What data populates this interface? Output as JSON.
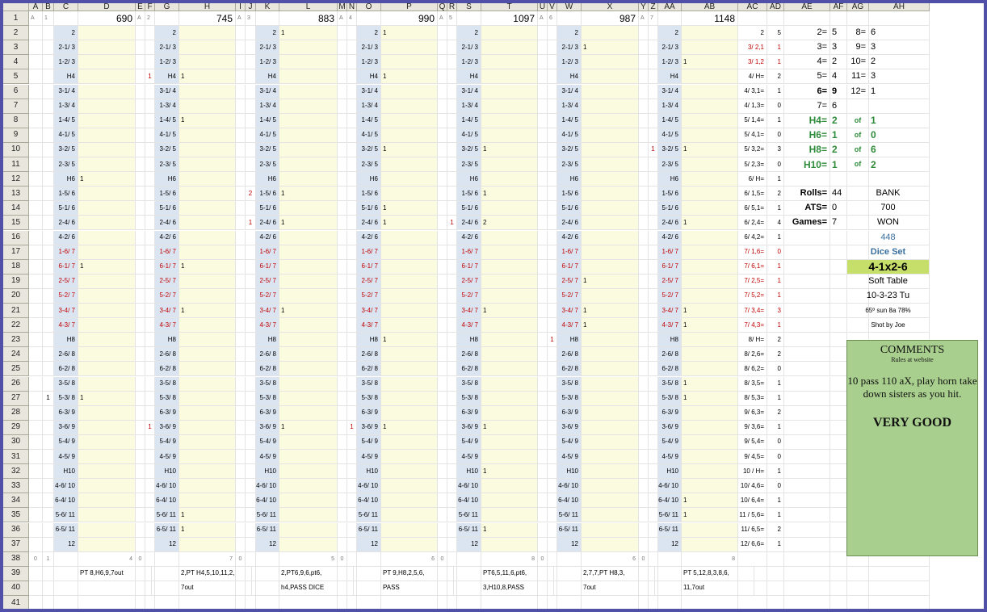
{
  "columns": [
    "A",
    "B",
    "C",
    "D",
    "E",
    "F",
    "G",
    "H",
    "I",
    "J",
    "K",
    "L",
    "M",
    "N",
    "O",
    "P",
    "Q",
    "R",
    "S",
    "T",
    "U",
    "V",
    "W",
    "X",
    "Y",
    "Z",
    "AA",
    "AB",
    "AC",
    "AD",
    "AE",
    "AF",
    "AG",
    "AH"
  ],
  "rows": [
    "1",
    "2",
    "3",
    "4",
    "5",
    "6",
    "7",
    "8",
    "9",
    "10",
    "11",
    "12",
    "13",
    "14",
    "15",
    "16",
    "17",
    "18",
    "19",
    "20",
    "21",
    "22",
    "23",
    "24",
    "25",
    "26",
    "27",
    "28",
    "29",
    "30",
    "31",
    "32",
    "33",
    "34",
    "35",
    "36",
    "37",
    "38",
    "39",
    "40",
    "41"
  ],
  "roll_labels": [
    "2",
    "2-1/ 3",
    "1-2/ 3",
    "H4",
    "3-1/ 4",
    "1-3/ 4",
    "1-4/ 5",
    "4-1/ 5",
    "3-2/ 5",
    "2-3/ 5",
    "H6",
    "1-5/ 6",
    "5-1/ 6",
    "2-4/ 6",
    "4-2/ 6",
    "1-6/ 7",
    "6-1/ 7",
    "2-5/ 7",
    "5-2/ 7",
    "3-4/ 7",
    "4-3/ 7",
    "H8",
    "2-6/ 8",
    "6-2/ 8",
    "3-5/ 8",
    "5-3/ 8",
    "6-3/ 9",
    "3-6/ 9",
    "5-4/ 9",
    "4-5/ 9",
    "H10",
    "4-6/ 10",
    "6-4/ 10",
    "5-6/ 11",
    "6-5/ 11",
    "12"
  ],
  "games": [
    {
      "letter": "A",
      "num": "1",
      "score": "690",
      "bottom_a": "0",
      "bottom_b": "1",
      "bottom_c": "4",
      "note1": "PT 8,H6,9,7out",
      "note2": "",
      "left_marks": {
        "27": "1"
      },
      "right_marks": {
        "2": "",
        "12": "1",
        "18": "1",
        "27": "1"
      }
    },
    {
      "letter": "A",
      "num": "2",
      "score": "745",
      "bottom_a": "0",
      "bottom_b": "",
      "bottom_c": "7",
      "note1": "2,PT H4,5,10,11,2,",
      "note2": "7out",
      "left_marks": {
        "5": "1",
        "29": "1"
      },
      "right_marks": {
        "5": "1",
        "8": "1",
        "18": "1",
        "21": "1",
        "35": "1",
        "36": "1"
      }
    },
    {
      "letter": "A",
      "num": "3",
      "score": "883",
      "bottom_a": "0",
      "bottom_b": "",
      "bottom_c": "5",
      "note1": "2,PT6,9,6,pt6,",
      "note2": "h4,PASS DICE",
      "left_marks": {
        "13": "2",
        "15": "1"
      },
      "right_marks": {
        "2": "1",
        "13": "1",
        "15": "1",
        "21": "1",
        "29": "1"
      }
    },
    {
      "letter": "A",
      "num": "4",
      "score": "990",
      "bottom_a": "0",
      "bottom_b": "",
      "bottom_c": "6",
      "note1": "PT 9,H8,2,5,6,",
      "note2": "PASS",
      "left_marks": {
        "29": "1"
      },
      "right_marks": {
        "2": "1",
        "5": "1",
        "10": "1",
        "14": "1",
        "15": "1",
        "23": "1",
        "29": "1"
      }
    },
    {
      "letter": "A",
      "num": "5",
      "score": "1097",
      "bottom_a": "0",
      "bottom_b": "",
      "bottom_c": "8",
      "note1": "PT6,5,11,6,pt6,",
      "note2": "3,H10,8,PASS",
      "left_marks": {
        "15": "1"
      },
      "right_marks": {
        "10": "1",
        "13": "1",
        "15": "2",
        "21": "1",
        "29": "1",
        "32": "1",
        "36": "1"
      }
    },
    {
      "letter": "A",
      "num": "6",
      "score": "987",
      "bottom_a": "0",
      "bottom_b": "",
      "bottom_c": "6",
      "note1": "2,7,7,PT H8,3,",
      "note2": "7out",
      "left_marks": {
        "23": "1"
      },
      "right_marks": {
        "3": "1",
        "19": "1",
        "21": "1",
        "22": "1"
      }
    },
    {
      "letter": "A",
      "num": "7",
      "score": "1148",
      "bottom_a": "0",
      "bottom_b": "",
      "bottom_c": "8",
      "note1": "PT 5,12,8,3,8,6,",
      "note2": "11,7out",
      "left_marks": {
        "10": "1"
      },
      "right_marks": {
        "4": "1",
        "10": "1",
        "15": "1",
        "21": "1",
        "22": "1",
        "26": "1",
        "27": "1",
        "34": "1",
        "35": "1"
      }
    }
  ],
  "ac_col": [
    "2",
    "3/ 2,1",
    "3/ 1,2",
    "4/ H=",
    "4/ 3,1=",
    "4/ 1,3=",
    "5/ 1,4=",
    "5/ 4,1=",
    "5/ 3,2=",
    "5/ 2,3=",
    "6/ H=",
    "6/ 1,5=",
    "6/ 5,1=",
    "6/ 2,4=",
    "6/ 4,2=",
    "7/ 1,6=",
    "7/ 6,1=",
    "7/ 2,5=",
    "7/ 5,2=",
    "7/ 3,4=",
    "7/ 4,3=",
    "8/ H=",
    "8/ 2,6=",
    "8/ 6,2=",
    "8/ 3,5=",
    "8/ 5,3=",
    "9/ 6,3=",
    "9/ 3,6=",
    "9/ 5,4=",
    "9/ 4,5=",
    "10 / H=",
    "10/ 4,6=",
    "10/ 6,4=",
    "11 / 5,6=",
    "11/ 6,5=",
    "12/ 6,6="
  ],
  "ad_col": [
    "5",
    "1",
    "1",
    "2",
    "1",
    "0",
    "1",
    "0",
    "3",
    "0",
    "1",
    "2",
    "1",
    "4",
    "1",
    "0",
    "1",
    "1",
    "1",
    "3",
    "1",
    "2",
    "2",
    "0",
    "1",
    "1",
    "2",
    "1",
    "0",
    "0",
    "1",
    "0",
    "1",
    "1",
    "2",
    "1"
  ],
  "totals": [
    {
      "left": "2=",
      "lv": "5",
      "right": "8=",
      "rv": "6"
    },
    {
      "left": "3=",
      "lv": "3",
      "right": "9=",
      "rv": "3"
    },
    {
      "left": "4=",
      "lv": "2",
      "right": "10=",
      "rv": "2"
    },
    {
      "left": "5=",
      "lv": "4",
      "right": "11=",
      "rv": "3"
    },
    {
      "left": "6=",
      "lv": "9",
      "right": "12=",
      "rv": "1"
    },
    {
      "left": "7=",
      "lv": "6",
      "right": "",
      "rv": ""
    }
  ],
  "hardways": [
    {
      "label": "H4=",
      "val": "2",
      "of": "of",
      "cnt": "1"
    },
    {
      "label": "H6=",
      "val": "1",
      "of": "of",
      "cnt": "0"
    },
    {
      "label": "H8=",
      "val": "2",
      "of": "of",
      "cnt": "6"
    },
    {
      "label": "H10=",
      "val": "1",
      "of": "of",
      "cnt": "2"
    }
  ],
  "stats": {
    "rolls_label": "Rolls=",
    "rolls": "44",
    "ats_label": "ATS=",
    "ats": "0",
    "games_label": "Games=",
    "games": "7"
  },
  "bank": {
    "bank_label": "BANK",
    "bank": "700",
    "won_label": "WON",
    "won": "448",
    "dice_set_label": "Dice Set",
    "dice_set": "4-1x2-6",
    "table": "Soft Table",
    "date": "10-3-23 Tu",
    "weather": "65º sun 8a 78%",
    "shot_by": "Shot by Joe"
  },
  "comments": {
    "title": "COMMENTS",
    "subtitle": "Rules at website",
    "body": "10 pass 110 aX, play horn take down sisters as you hit.",
    "verdict": "VERY GOOD"
  },
  "colors": {
    "blue_cell": "#dbe5f1",
    "yellow_cell": "#fbfbdf",
    "header": "#e9e7dd",
    "red_text": "#c00000",
    "green_text": "#2e8b3a",
    "comments_bg": "#a9cf8e",
    "frame": "#5050a8"
  }
}
